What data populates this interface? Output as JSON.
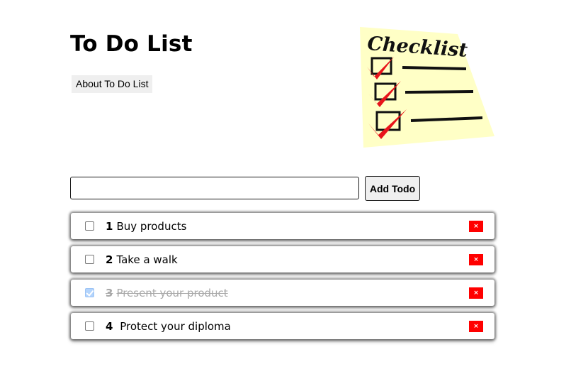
{
  "header": {
    "title": "To Do List",
    "about_button": "About To Do List"
  },
  "checklist_image": {
    "icon": "checklist-illustration",
    "caption": "Checklist",
    "paper_color": "#ffffc6",
    "check_color": "#e8141b"
  },
  "form": {
    "input_value": "",
    "input_placeholder": "",
    "add_button": "Add Todo"
  },
  "todos": [
    {
      "number": "1",
      "text": "Buy products",
      "completed": false,
      "delete_label": "×"
    },
    {
      "number": "2",
      "text": "Take a walk",
      "completed": false,
      "delete_label": "×"
    },
    {
      "number": "3",
      "text": "Present your product",
      "completed": true,
      "delete_label": "×"
    },
    {
      "number": "4",
      "text": " Protect your diploma",
      "completed": false,
      "delete_label": "×"
    }
  ],
  "colors": {
    "delete_button": "#ff0000",
    "completed_text": "#a8a8a8",
    "checkbox_checked": "#b3d4fc"
  }
}
